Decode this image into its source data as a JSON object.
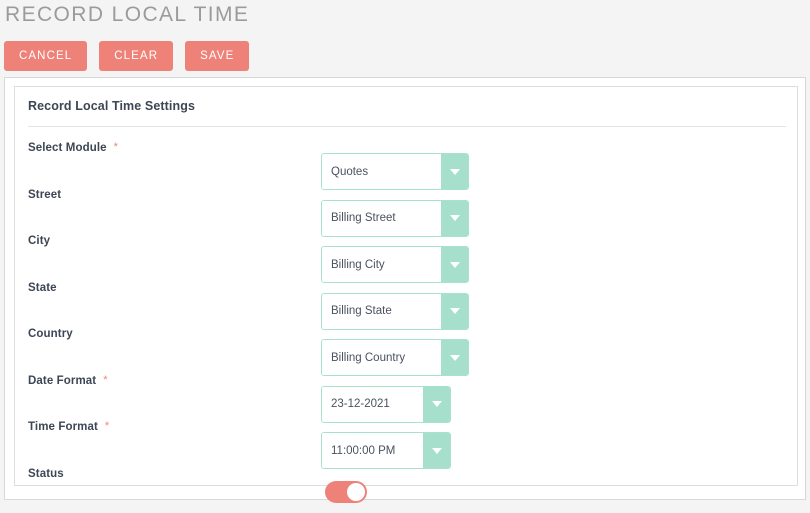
{
  "page": {
    "title": "RECORD LOCAL TIME"
  },
  "toolbar": {
    "buttons": [
      {
        "label": "CANCEL",
        "name": "cancel-button"
      },
      {
        "label": "CLEAR",
        "name": "clear-button"
      },
      {
        "label": "SAVE",
        "name": "save-button"
      }
    ],
    "color": "#ef8278"
  },
  "card": {
    "heading": "Record Local Time Settings"
  },
  "form": {
    "required_marker": "*",
    "rows": [
      {
        "label": "Select Module",
        "required": true,
        "control": "select",
        "width": "wide",
        "value": "Quotes",
        "name": "select-module"
      },
      {
        "label": "Street",
        "required": false,
        "control": "select",
        "width": "wide",
        "value": "Billing Street",
        "name": "street"
      },
      {
        "label": "City",
        "required": false,
        "control": "select",
        "width": "wide",
        "value": "Billing City",
        "name": "city"
      },
      {
        "label": "State",
        "required": false,
        "control": "select",
        "width": "wide",
        "value": "Billing State",
        "name": "state"
      },
      {
        "label": "Country",
        "required": false,
        "control": "select",
        "width": "wide",
        "value": "Billing Country",
        "name": "country"
      },
      {
        "label": "Date Format",
        "required": true,
        "control": "select",
        "width": "narrow",
        "value": "23-12-2021",
        "name": "date-format"
      },
      {
        "label": "Time Format",
        "required": true,
        "control": "select",
        "width": "narrow",
        "value": "11:00:00 PM",
        "name": "time-format"
      },
      {
        "label": "Status",
        "required": false,
        "control": "toggle",
        "value": "on",
        "name": "status"
      }
    ]
  },
  "theme": {
    "accent": "#ef8278",
    "select_border": "#a8e2cf",
    "select_button": "#a6e0cd",
    "page_background": "#f4f4f4",
    "label_text": "#3d4654"
  }
}
